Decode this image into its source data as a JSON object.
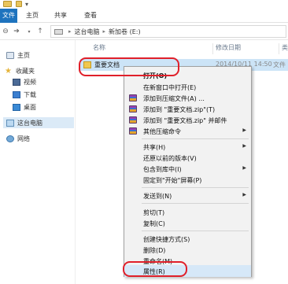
{
  "ribbon": {
    "tabs": [
      {
        "label": "文件"
      },
      {
        "label": "主页"
      },
      {
        "label": "共享"
      },
      {
        "label": "查看"
      }
    ]
  },
  "address": {
    "crumbs": [
      "这台电脑",
      "新加卷 (E:)"
    ],
    "separator": "▸"
  },
  "nav": {
    "items": [
      {
        "label": "主页"
      },
      {
        "label": "收藏夹"
      },
      {
        "label": "视频"
      },
      {
        "label": "下载"
      },
      {
        "label": "桌面"
      },
      {
        "label": "这台电脑"
      },
      {
        "label": "网络"
      }
    ]
  },
  "columns": {
    "name": "名称",
    "date": "修改日期",
    "type": "类型"
  },
  "file": {
    "name": "重要文档",
    "date": "2014/10/11 14:50",
    "type": "文件"
  },
  "menu": {
    "items": [
      {
        "label": "打开(O)"
      },
      {
        "label": "在新窗口中打开(E)"
      },
      {
        "label": "添加到压缩文件(A) ..."
      },
      {
        "label": "添加到 \"重要文档.zip\"(T)"
      },
      {
        "label": "添加到 \"重要文档.zip\" 并邮件"
      },
      {
        "label": "其他压缩命令"
      },
      {
        "label": "共享(H)"
      },
      {
        "label": "还原以前的版本(V)"
      },
      {
        "label": "包含到库中(I)"
      },
      {
        "label": "固定到\"开始\"屏幕(P)"
      },
      {
        "label": "发送到(N)"
      },
      {
        "label": "剪切(T)"
      },
      {
        "label": "复制(C)"
      },
      {
        "label": "创建快捷方式(S)"
      },
      {
        "label": "删除(D)"
      },
      {
        "label": "重命名(M)"
      },
      {
        "label": "属性(R)"
      }
    ],
    "submenu_arrow": "▶"
  },
  "colors": {
    "file_tab": "#1e73be",
    "selection": "#cce4f7",
    "annotation": "#e0202a"
  }
}
